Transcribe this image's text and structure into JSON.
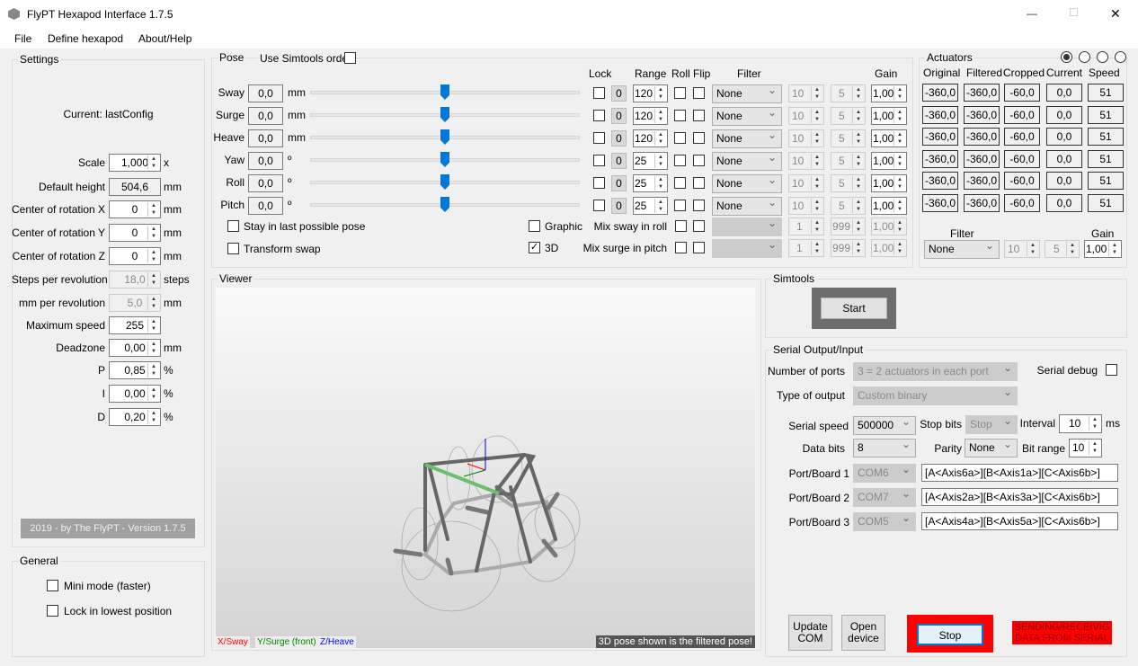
{
  "window": {
    "title": "FlyPT Hexapod Interface 1.7.5",
    "minimize": "—",
    "maximize": "☐",
    "close": "✕"
  },
  "menu": [
    "File",
    "Define hexapod",
    "About/Help"
  ],
  "settings": {
    "title": "Settings",
    "current": "Current: lastConfig",
    "rows": [
      {
        "label": "Scale",
        "value": "1,000",
        "unit": "x",
        "kind": "spin"
      },
      {
        "label": "Default height",
        "value": "504,6",
        "unit": "mm",
        "kind": "ro"
      },
      {
        "label": "Center of rotation X",
        "value": "0",
        "unit": "mm",
        "kind": "spin"
      },
      {
        "label": "Center of rotation Y",
        "value": "0",
        "unit": "mm",
        "kind": "spin"
      },
      {
        "label": "Center of rotation Z",
        "value": "0",
        "unit": "mm",
        "kind": "spin"
      },
      {
        "label": "Steps per revolution",
        "value": "18,0",
        "unit": "steps",
        "kind": "dis"
      },
      {
        "label": "mm per revolution",
        "value": "5,0",
        "unit": "mm",
        "kind": "dis"
      },
      {
        "label": "Maximum speed",
        "value": "255",
        "unit": "",
        "kind": "spin"
      },
      {
        "label": "Deadzone",
        "value": "0,00",
        "unit": "mm",
        "kind": "spin"
      },
      {
        "label": "P",
        "value": "0,85",
        "unit": "%",
        "kind": "spin"
      },
      {
        "label": "I",
        "value": "0,00",
        "unit": "%",
        "kind": "spin"
      },
      {
        "label": "D",
        "value": "0,20",
        "unit": "%",
        "kind": "spin"
      }
    ],
    "footer": "2019 - by The FlyPT - Version 1.7.5"
  },
  "general": {
    "title": "General",
    "mini_mode": "Mini mode (faster)",
    "lock_lowest": "Lock in lowest position"
  },
  "pose": {
    "title": "Pose",
    "use_simtools": "Use Simtools order",
    "headers": {
      "lock": "Lock",
      "range": "Range",
      "roll": "Roll",
      "flip": "Flip",
      "filter": "Filter",
      "gain": "Gain"
    },
    "rows": [
      {
        "label": "Sway",
        "value": "0,0",
        "unit": "mm",
        "zero": "0",
        "range": "120",
        "filter": "None",
        "f1": "10",
        "f2": "5",
        "gain": "1,00",
        "slider": 0.5
      },
      {
        "label": "Surge",
        "value": "0,0",
        "unit": "mm",
        "zero": "0",
        "range": "120",
        "filter": "None",
        "f1": "10",
        "f2": "5",
        "gain": "1,00",
        "slider": 0.5
      },
      {
        "label": "Heave",
        "value": "0,0",
        "unit": "mm",
        "zero": "0",
        "range": "120",
        "filter": "None",
        "f1": "10",
        "f2": "5",
        "gain": "1,00",
        "slider": 0.5
      },
      {
        "label": "Yaw",
        "value": "0,0",
        "unit": "º",
        "zero": "0",
        "range": "25",
        "filter": "None",
        "f1": "10",
        "f2": "5",
        "gain": "1,00",
        "slider": 0.5
      },
      {
        "label": "Roll",
        "value": "0,0",
        "unit": "º",
        "zero": "0",
        "range": "25",
        "filter": "None",
        "f1": "10",
        "f2": "5",
        "gain": "1,00",
        "slider": 0.5
      },
      {
        "label": "Pitch",
        "value": "0,0",
        "unit": "º",
        "zero": "0",
        "range": "25",
        "filter": "None",
        "f1": "10",
        "f2": "5",
        "gain": "1,00",
        "slider": 0.5
      }
    ],
    "stay_last": "Stay in last possible pose",
    "transform_swap": "Transform swap",
    "graphic": "Graphic",
    "three_d": "3D",
    "three_d_checked": true,
    "mix": [
      {
        "label": "Mix sway in roll",
        "v1": "1",
        "v2": "999",
        "gain": "1,00"
      },
      {
        "label": "Mix surge in pitch",
        "v1": "1",
        "v2": "999",
        "gain": "1,00"
      }
    ]
  },
  "actuators": {
    "title": "Actuators",
    "headers": [
      "Original",
      "Filtered",
      "Cropped",
      "Current",
      "Speed"
    ],
    "rows": [
      [
        "-360,0",
        "-360,0",
        "-60,0",
        "0,0",
        "51"
      ],
      [
        "-360,0",
        "-360,0",
        "-60,0",
        "0,0",
        "51"
      ],
      [
        "-360,0",
        "-360,0",
        "-60,0",
        "0,0",
        "51"
      ],
      [
        "-360,0",
        "-360,0",
        "-60,0",
        "0,0",
        "51"
      ],
      [
        "-360,0",
        "-360,0",
        "-60,0",
        "0,0",
        "51"
      ],
      [
        "-360,0",
        "-360,0",
        "-60,0",
        "0,0",
        "51"
      ]
    ],
    "filter_label": "Filter",
    "filter": "None",
    "f1": "10",
    "f2": "5",
    "gain_label": "Gain",
    "gain": "1,00",
    "selected_radio": 0
  },
  "viewer": {
    "title": "Viewer",
    "x_label": "X/Sway",
    "y_label": "Y/Surge (front)",
    "z_label": "Z/Heave",
    "note": "3D pose shown is the filtered pose!",
    "colors": {
      "x": "#ff0000",
      "y": "#008000",
      "z": "#0000ff"
    }
  },
  "simtools": {
    "title": "Simtools",
    "start": "Start"
  },
  "serial": {
    "title": "Serial Output/Input",
    "num_ports_label": "Number of ports",
    "num_ports": "3 = 2 actuators in each port",
    "output_label": "Type of output",
    "output": "Custom binary",
    "debug": "Serial debug",
    "speed_label": "Serial speed",
    "speed": "500000",
    "stop_label": "Stop bits",
    "stop": "Stop",
    "interval_label": "Interval",
    "interval": "10",
    "interval_unit": "ms",
    "databits_label": "Data bits",
    "databits": "8",
    "parity_label": "Parity",
    "parity": "None",
    "bitrange_label": "Bit range",
    "bitrange": "10",
    "ports": [
      {
        "label": "Port/Board 1",
        "com": "COM6",
        "fmt": "[A<Axis6a>][B<Axis1a>][C<Axis6b>]"
      },
      {
        "label": "Port/Board 2",
        "com": "COM7",
        "fmt": "[A<Axis2a>][B<Axis3a>][C<Axis6b>]"
      },
      {
        "label": "Port/Board 3",
        "com": "COM5",
        "fmt": "[A<Axis4a>][B<Axis5a>][C<Axis6b>]"
      }
    ],
    "update_com": "Update COM",
    "open_device": "Open device",
    "status": "SENDING/RECEIVIG DATA FROM SERIAL",
    "status_color": "#ff0000"
  }
}
